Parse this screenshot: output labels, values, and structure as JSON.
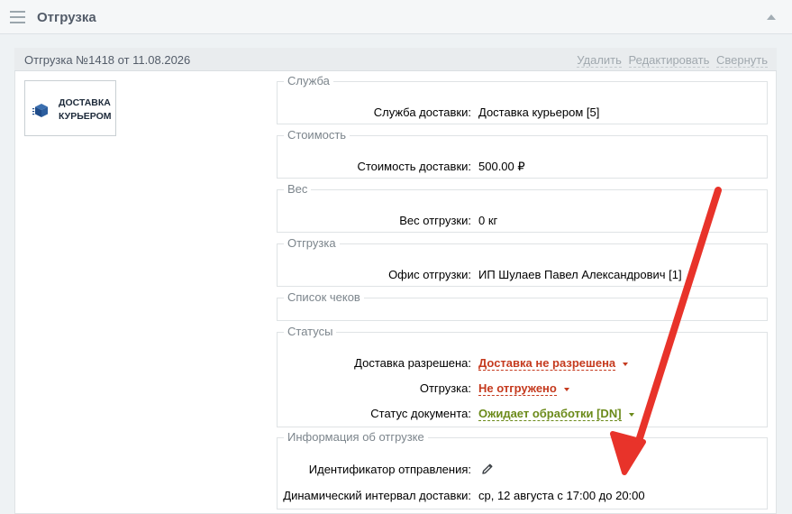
{
  "panel": {
    "title": "Отгрузка",
    "menu_icon": "hamburger-icon",
    "collapse_icon": "chevron-up-icon"
  },
  "shipment": {
    "title": "Отгрузка №1418 от 11.08.2026",
    "actions": {
      "delete": "Удалить",
      "edit": "Редактировать",
      "collapse": "Свернуть"
    },
    "logo_text": "ДОСТАВКА КУРЬЕРОМ",
    "logo_icon": "box-icon"
  },
  "sections": {
    "service": {
      "legend": "Служба",
      "label": "Служба доставки:",
      "value": "Доставка курьером [5]"
    },
    "cost": {
      "legend": "Стоимость",
      "label": "Стоимость доставки:",
      "value": "500.00 ₽"
    },
    "weight": {
      "legend": "Вес",
      "label": "Вес отгрузки:",
      "value": "0 кг"
    },
    "shipping": {
      "legend": "Отгрузка",
      "label": "Офис отгрузки:",
      "value": "ИП Шулаев Павел Александрович [1]"
    },
    "receipts": {
      "legend": "Список чеков"
    },
    "statuses": {
      "legend": "Статусы",
      "delivery_allowed_label": "Доставка разрешена:",
      "delivery_allowed_value": "Доставка не разрешена",
      "shipped_label": "Отгрузка:",
      "shipped_value": "Не отгружено",
      "doc_status_label": "Статус документа:",
      "doc_status_value": "Ожидает обработки [DN]"
    },
    "info": {
      "legend": "Информация об отгрузке",
      "tracking_label": "Идентификатор отправления:",
      "tracking_icon": "pencil-icon",
      "interval_label": "Динамический интервал доставки:",
      "interval_value": "ср, 12 августа с 17:00 до 20:00"
    }
  },
  "colors": {
    "status_red": "#c53a1e",
    "status_green": "#6b8a1a",
    "arrow": "#e8332a"
  }
}
